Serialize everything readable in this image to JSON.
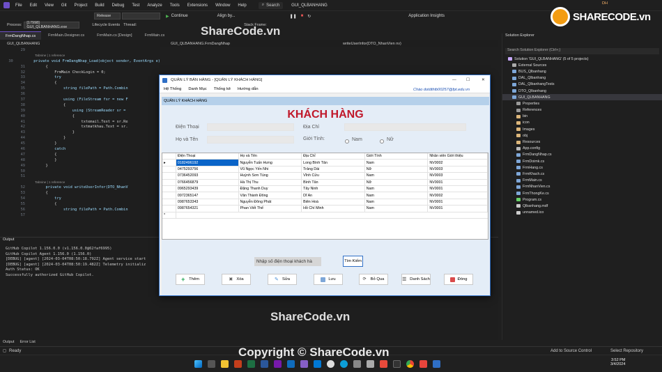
{
  "vs": {
    "menu": [
      "File",
      "Edit",
      "View",
      "Git",
      "Project",
      "Build",
      "Debug",
      "Test",
      "Analyze",
      "Tools",
      "Extensions",
      "Window",
      "Help"
    ],
    "search": "Search",
    "solution_title": "GUI_QLBANHANG",
    "user_badge": "DH",
    "toolbar": {
      "config": "Release",
      "continue": "Continue",
      "align": "Align by...",
      "insights": "Application Insights",
      "process_label": "Process:",
      "process": "[17998] GUI_QLBANHANG.exe",
      "lifecycle": "Lifecycle Events",
      "thread": "Thread:",
      "stack": "Stack Frame:"
    },
    "doc_tabs": [
      "FrmDangNhap.cs",
      "FrmMain.Designer.cs",
      "FrmMain.cs [Design]",
      "FrmMain.cs"
    ],
    "nav": {
      "project": "GUI_QLBANHANG",
      "class": "GUI_QLBANHANG.FrmDangNhap",
      "method": "writeUserInfor(DTO_NhanVien nv)"
    },
    "code": [
      {
        "n": "29",
        "t": ""
      },
      {
        "n": "",
        "t": "        Tabnine | 1 reference"
      },
      {
        "n": "30",
        "t": "        private void FrmDangNhap_Load(object sender, EventArgs e)"
      },
      {
        "n": "31",
        "t": "        {"
      },
      {
        "n": "32",
        "t": "            FrmMain CheckLogin = 0;"
      },
      {
        "n": "33",
        "t": "            try"
      },
      {
        "n": "34",
        "t": "            {"
      },
      {
        "n": "35",
        "t": "                string filePath = Path.Combin"
      },
      {
        "n": "36",
        "t": ""
      },
      {
        "n": "37",
        "t": "                using (FileStream fsr = new F"
      },
      {
        "n": "38",
        "t": "                {"
      },
      {
        "n": "39",
        "t": "                    using (StreamReader sr ="
      },
      {
        "n": "40",
        "t": "                    {"
      },
      {
        "n": "41",
        "t": "                        txtemail.Text = sr.Re"
      },
      {
        "n": "42",
        "t": "                        txtmatkhau.Text = sr."
      },
      {
        "n": "43",
        "t": "                    }"
      },
      {
        "n": "44",
        "t": "                }"
      },
      {
        "n": "45",
        "t": "            }"
      },
      {
        "n": "46",
        "t": "            catch"
      },
      {
        "n": "47",
        "t": "            {"
      },
      {
        "n": "48",
        "t": "            }"
      },
      {
        "n": "49",
        "t": "        }"
      },
      {
        "n": "50",
        "t": ""
      },
      {
        "n": "51",
        "t": ""
      },
      {
        "n": "",
        "t": "        Tabnine | 1 reference"
      },
      {
        "n": "52",
        "t": "        private void writeUserInfor(DTO_NhanV"
      },
      {
        "n": "53",
        "t": "        {"
      },
      {
        "n": "54",
        "t": "            try"
      },
      {
        "n": "55",
        "t": "            {"
      },
      {
        "n": "56",
        "t": "                string filePath = Path.Combin"
      },
      {
        "n": "57",
        "t": ""
      }
    ],
    "output_title": "Output",
    "output_lines": [
      "GitHub Copilot 1.156.0.0 (v1.156.0.0@62faf6995)",
      "GitHub Copilot Agent 1.156.0 (1.156.0)",
      "[DEBUG] [agent] [2024-03-04T08:50:18.792Z] Agent service start",
      "[DEBUG] [agent] [2024-03-04T08:50:19.482Z] Telemetry initializ",
      "Auth Status: OK",
      "Successfully authorized GitHub Copilot."
    ],
    "output_tabs": [
      "Output",
      "Error List"
    ],
    "status": {
      "ready": "Ready",
      "source_control": "Add to Source Control",
      "repo": "Select Repository"
    },
    "clock": {
      "time": "3:52 PM",
      "date": "3/4/2024"
    },
    "solution_explorer": {
      "title": "Solution Explorer",
      "search_placeholder": "Search Solution Explorer (Ctrl+;)",
      "items": [
        "Solution 'GUI_QLBANHANG' (5 of 5 projects)",
        "External Sources",
        "BUS_Qlbanhang",
        "DAL_Qlbanhang",
        "DAL_QlbanhangTests",
        "DTO_Qlbanhang",
        "GUI_QLBANHANG",
        "Properties",
        "References",
        "bin",
        "icon",
        "Images",
        "obj",
        "Resources",
        "App.config",
        "FrmDangNhap.cs",
        "FrmDoimk.cs",
        "FrmHang.cs",
        "FrmKhach.cs",
        "FrmMain.cs",
        "FrmNhanVien.cs",
        "FrmThongKe.cs",
        "Program.cs",
        "Qlbanhang.mdf",
        "unnamed.ico"
      ]
    }
  },
  "app": {
    "title": "QUẢN LÝ BÁN HÀNG - [QUẢN LÝ KHÁCH HÀNG]",
    "menu": [
      "Hệ Thống",
      "Danh Mục",
      "Thống kê",
      "Hướng dẫn"
    ],
    "greeting": "Chào dotdthtb00257@fpt.edu.vn",
    "group": "QUẢN LÝ KHÁCH HÀNG",
    "heading": "KHÁCH HÀNG",
    "labels": {
      "phone": "Điện Thoại",
      "address": "Địa Chỉ",
      "name": "Họ và Tên",
      "gender": "Giới Tính:",
      "male": "Nam",
      "female": "Nữ"
    },
    "columns": [
      "Điện Thoại",
      "Họ và Tên",
      "Địa Chỉ",
      "Giới Tính",
      "Nhân viên Giới thiệu"
    ],
    "rows": [
      [
        "0182496192",
        "Nguyễn Tuấn Hưng",
        "Long Bình Tân",
        "Nam",
        "NV0002"
      ],
      [
        "0475293756",
        "Vũ Ngọc Yến Nhi",
        "Trảng Dài",
        "Nữ",
        "NV0003"
      ],
      [
        "0736452093",
        "Huỳnh Sơn Tùng",
        "Vĩnh Cửu",
        "Nam",
        "NV0003"
      ],
      [
        "0766456879",
        "Hà Thị Thu",
        "Bình Tân",
        "Nữ",
        "NV0001"
      ],
      [
        "0965293439",
        "Đặng Thanh Duy",
        "Tây Ninh",
        "Nam",
        "NV0001"
      ],
      [
        "0972365147",
        "Văn Thành Đông",
        "Dĩ An",
        "Nam",
        "NV0002"
      ],
      [
        "0987653343",
        "Nguyễn Đông Phát",
        "Biên Hoà",
        "Nam",
        "NV0001"
      ],
      [
        "0987654321",
        "Phan Viết Thế",
        "Hồ Chí Minh",
        "Nam",
        "NV0001"
      ]
    ],
    "search_placeholder": "Nhập số điện thoại khách hà",
    "search_button": "Tìm Kiếm",
    "buttons": {
      "add": "Thêm",
      "delete": "Xóa",
      "edit": "Sửa",
      "save": "Lưu",
      "skip": "Bỏ Qua",
      "list": "Danh Sách",
      "close": "Đóng"
    }
  },
  "watermark": {
    "top": "ShareCode.vn",
    "middle": "ShareCode.vn",
    "bottom": "Copyright © ShareCode.vn",
    "logo": "SHARECODE.vn"
  },
  "colors": {
    "accent": "#6d4fc8",
    "app_border": "#2f6fc6",
    "heading_red": "#c0182a",
    "group_bar": "#b5d0ea",
    "panel_bg": "#e4edf7"
  }
}
